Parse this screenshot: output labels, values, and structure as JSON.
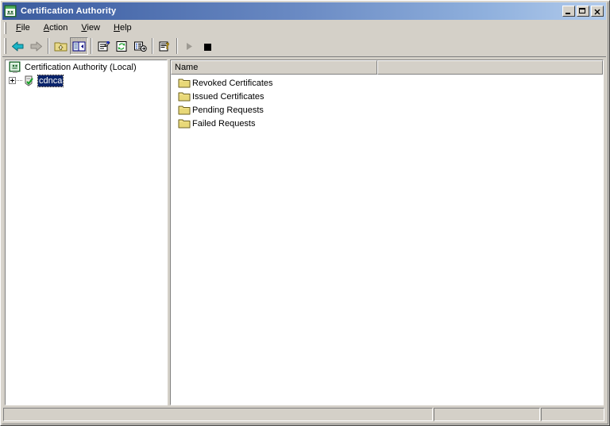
{
  "window": {
    "title": "Certification Authority",
    "icon": "mmc-console-icon",
    "controls": {
      "minimize": "Minimize",
      "maximize": "Maximize",
      "close": "Close"
    }
  },
  "menubar": {
    "items": [
      {
        "label": "File",
        "accel": "F"
      },
      {
        "label": "Action",
        "accel": "A"
      },
      {
        "label": "View",
        "accel": "V"
      },
      {
        "label": "Help",
        "accel": "H"
      }
    ]
  },
  "toolbar": {
    "buttons": [
      {
        "name": "back-button",
        "icon": "arrow-left-icon",
        "enabled": true,
        "pressed": false
      },
      {
        "name": "forward-button",
        "icon": "arrow-right-icon",
        "enabled": false,
        "pressed": false
      },
      {
        "name": "up-one-level-button",
        "icon": "folder-up-icon",
        "enabled": true,
        "pressed": false
      },
      {
        "name": "show-console-tree-button",
        "icon": "console-tree-icon",
        "enabled": true,
        "pressed": true
      },
      {
        "name": "properties-button",
        "icon": "properties-icon",
        "enabled": true,
        "pressed": false
      },
      {
        "name": "refresh-button",
        "icon": "refresh-icon",
        "enabled": true,
        "pressed": false
      },
      {
        "name": "export-list-button",
        "icon": "export-list-icon",
        "enabled": true,
        "pressed": false
      },
      {
        "name": "help-button",
        "icon": "help-question-icon",
        "enabled": true,
        "pressed": false
      },
      {
        "name": "start-service-button",
        "icon": "play-triangle-icon",
        "enabled": false,
        "pressed": false
      },
      {
        "name": "stop-service-button",
        "icon": "stop-square-icon",
        "enabled": true,
        "pressed": false
      }
    ]
  },
  "tree": {
    "root": {
      "label": "Certification Authority (Local)",
      "icon": "mmc-console-icon",
      "selected": false
    },
    "child": {
      "label": "cdnca",
      "icon": "ca-shield-check-icon",
      "selected": true,
      "expandable": true,
      "expanded": false
    }
  },
  "listview": {
    "columns": [
      "Name",
      ""
    ],
    "rows": [
      {
        "name": "Revoked Certificates",
        "icon": "folder-icon"
      },
      {
        "name": "Issued Certificates",
        "icon": "folder-icon"
      },
      {
        "name": "Pending Requests",
        "icon": "folder-icon"
      },
      {
        "name": "Failed Requests",
        "icon": "folder-icon"
      }
    ]
  },
  "statusbar": {
    "panes": [
      "",
      "",
      ""
    ]
  }
}
